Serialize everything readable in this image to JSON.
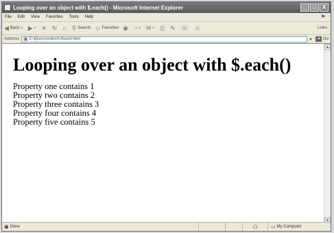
{
  "window": {
    "title": "Looping over an object with $.each() - Microsoft Internet Explorer",
    "min": "_",
    "max": "□",
    "close": "X"
  },
  "menu": {
    "items": [
      "File",
      "Edit",
      "View",
      "Favorites",
      "Tools",
      "Help"
    ]
  },
  "toolbar": {
    "back": "Back",
    "search": "Search",
    "favorites": "Favorites",
    "links": "Links"
  },
  "address": {
    "label": "Address",
    "value": "C:\\jQuery\\code\\ch-6\\each.html",
    "go": "Go"
  },
  "page": {
    "heading": "Looping over an object with $.each()",
    "lines": [
      "Property one contains 1",
      "Property two contains 2",
      "Property three contains 3",
      "Property four contains 4",
      "Property five contains 5"
    ]
  },
  "status": {
    "text": "Done",
    "zone": "My Computer"
  }
}
